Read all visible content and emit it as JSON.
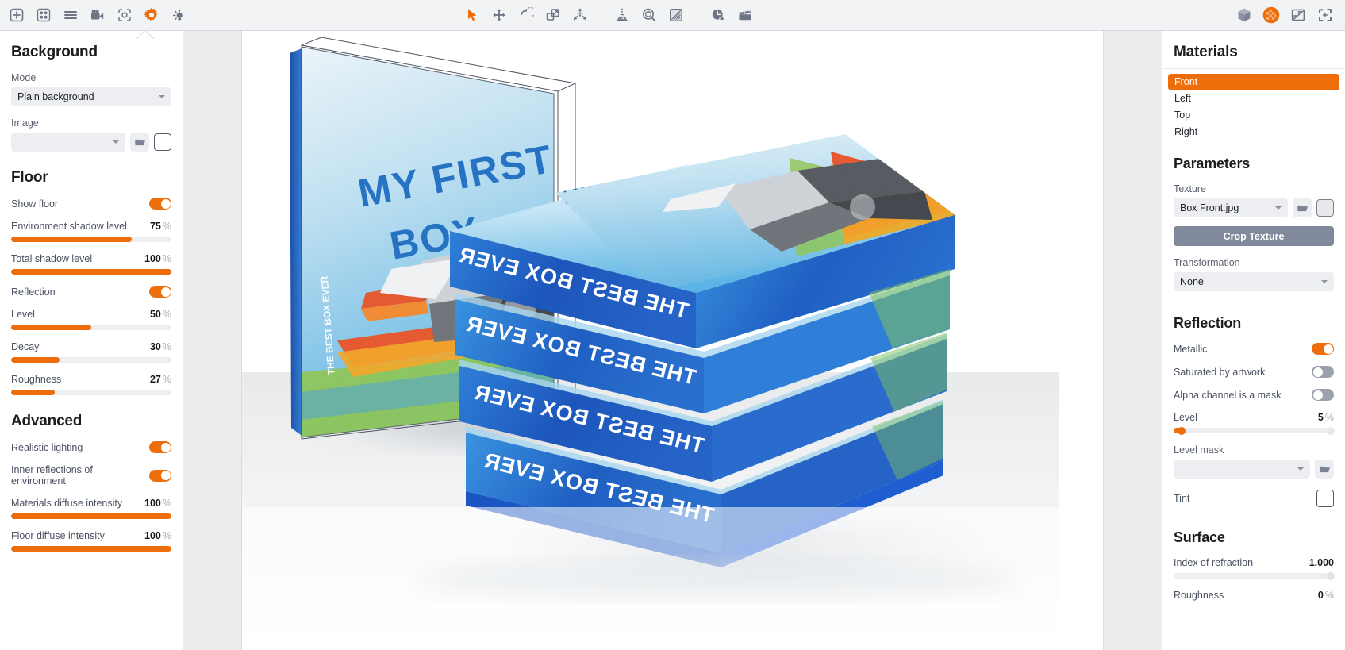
{
  "toolbar": {
    "left_items": [
      {
        "name": "add-object-icon",
        "label": "Add object"
      },
      {
        "name": "grid-layout-icon",
        "label": "Layout"
      },
      {
        "name": "list-icon",
        "label": "List"
      },
      {
        "name": "camera-icon",
        "label": "Camera"
      },
      {
        "name": "snapshot-icon",
        "label": "Snapshot"
      },
      {
        "name": "settings-gear-icon",
        "label": "Settings"
      },
      {
        "name": "lighting-icon",
        "label": "Lighting"
      }
    ],
    "center_items": [
      {
        "name": "select-cursor-icon",
        "label": "Select"
      },
      {
        "name": "move-icon",
        "label": "Move"
      },
      {
        "name": "rotate-icon",
        "label": "Rotate"
      },
      {
        "name": "scale-icon",
        "label": "Scale"
      },
      {
        "name": "explode-icon",
        "label": "Explode"
      },
      {
        "name": "align-icon",
        "label": "Align"
      },
      {
        "name": "inspect-icon",
        "label": "Inspect"
      },
      {
        "name": "shading-icon",
        "label": "Shading"
      },
      {
        "name": "history-icon",
        "label": "History"
      },
      {
        "name": "animation-icon",
        "label": "Animation"
      }
    ],
    "right_items": [
      {
        "name": "cube-icon",
        "label": "3D view"
      },
      {
        "name": "render-sphere-icon",
        "label": "Render"
      },
      {
        "name": "export-image-icon",
        "label": "Export"
      },
      {
        "name": "fullscreen-icon",
        "label": "Fullscreen"
      }
    ],
    "active_left_index": 5,
    "accent_color": "#ed6d0b",
    "icon_color": "#6d7585"
  },
  "left_panel": {
    "background": {
      "title": "Background",
      "mode_label": "Mode",
      "mode_value": "Plain background",
      "image_label": "Image",
      "image_value": "",
      "browse_icon": "folder-icon",
      "color_swatch": "#ffffff"
    },
    "floor": {
      "title": "Floor",
      "show_floor_label": "Show floor",
      "show_floor_on": true,
      "sliders": [
        {
          "label": "Environment shadow level",
          "value": "75",
          "unit": "%",
          "percent": 75
        },
        {
          "label": "Total shadow level",
          "value": "100",
          "unit": "%",
          "percent": 100
        }
      ],
      "reflection_label": "Reflection",
      "reflection_on": true,
      "reflection_sliders": [
        {
          "label": "Level",
          "value": "50",
          "unit": "%",
          "percent": 50
        },
        {
          "label": "Decay",
          "value": "30",
          "unit": "%",
          "percent": 30
        },
        {
          "label": "Roughness",
          "value": "27",
          "unit": "%",
          "percent": 27
        }
      ]
    },
    "advanced": {
      "title": "Advanced",
      "toggles": [
        {
          "label": "Realistic lighting",
          "on": true
        },
        {
          "label": "Inner reflections of environment",
          "on": true
        }
      ],
      "sliders": [
        {
          "label": "Materials diffuse intensity",
          "value": "100",
          "unit": "%",
          "percent": 100
        },
        {
          "label": "Floor diffuse intensity",
          "value": "100",
          "unit": "%",
          "percent": 100
        }
      ]
    }
  },
  "right_panel": {
    "materials": {
      "title": "Materials",
      "items": [
        {
          "label": "Front",
          "selected": true
        },
        {
          "label": "Left",
          "selected": false
        },
        {
          "label": "Top",
          "selected": false
        },
        {
          "label": "Right",
          "selected": false
        }
      ]
    },
    "parameters": {
      "title": "Parameters",
      "texture_label": "Texture",
      "texture_value": "Box Front.jpg",
      "browse_icon": "folder-icon",
      "texture_swatch": "#e7e8ea",
      "crop_button": "Crop Texture",
      "transformation_label": "Transformation",
      "transformation_value": "None"
    },
    "reflection": {
      "title": "Reflection",
      "toggles": [
        {
          "label": "Metallic",
          "on": true
        },
        {
          "label": "Saturated by artwork",
          "on": false
        },
        {
          "label": "Alpha channel is a mask",
          "on": false
        }
      ],
      "level_label": "Level",
      "level_value": "5",
      "level_unit": "%",
      "level_percent": 5,
      "level_mask_label": "Level mask",
      "level_mask_value": "",
      "tint_label": "Tint",
      "tint_color": "#ffffff"
    },
    "surface": {
      "title": "Surface",
      "ior_label": "Index of refraction",
      "ior_value": "1.000",
      "ior_percent": 0,
      "roughness_label": "Roughness",
      "roughness_value": "0",
      "roughness_unit": "%"
    }
  },
  "viewport": {
    "artwork": {
      "front_title_line1": "MY FIRST",
      "front_title_line2": "BOX",
      "spine_text": "THE BEST BOX EVER",
      "spine_count": 4,
      "title_color": "#1e6fc4",
      "sky_color": "#9fd4ef",
      "box_blue": "#1f63c8"
    }
  }
}
